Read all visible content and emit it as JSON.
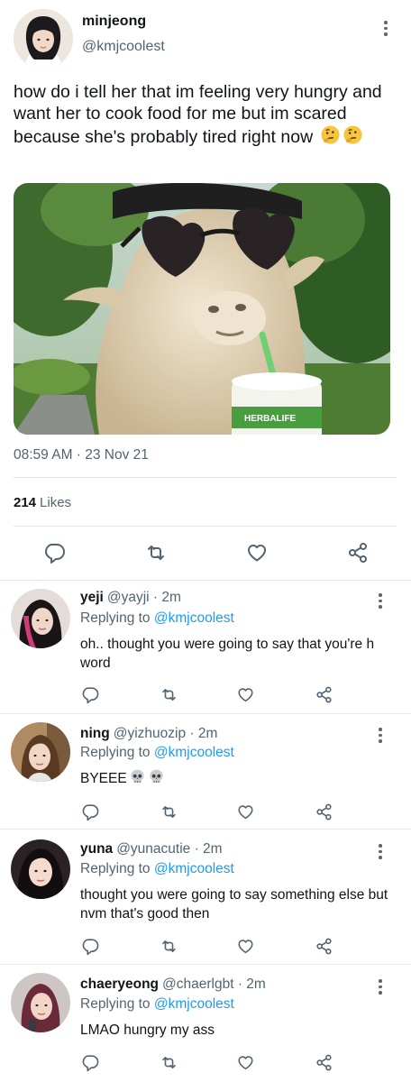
{
  "tweet": {
    "author_name": "minjeong",
    "author_handle": "@kmjcoolest",
    "text": "how do i tell her that im feeling very hungry and want her to cook food for me but im scared because she's probably tired right now",
    "emojis": [
      "thinking-face",
      "thinking-face"
    ],
    "media_label": "HERBALIFE",
    "timestamp": "08:59 AM · 23 Nov 21",
    "likes_count": "214",
    "likes_label": "Likes"
  },
  "icons": {
    "reply": "reply-icon",
    "retweet": "retweet-icon",
    "like": "heart-icon",
    "share": "share-icon",
    "more": "more-icon"
  },
  "colors": {
    "link": "#1d9bf0",
    "secondary_text": "#536471",
    "primary_text": "#0f1419"
  },
  "replies": [
    {
      "name": "yeji",
      "handle": "@yayji",
      "time": "· 2m",
      "replying_prefix": "Replying to",
      "replying_handle": "@kmjcoolest",
      "text": "oh.. thought you were going to say that you're h word"
    },
    {
      "name": "ning",
      "handle": "@yizhuozip",
      "time": "· 2m",
      "replying_prefix": "Replying to",
      "replying_handle": "@kmjcoolest",
      "text": "BYEEE",
      "emojis": [
        "skull",
        "skull"
      ]
    },
    {
      "name": "yuna",
      "handle": "@yunacutie",
      "time": "· 2m",
      "replying_prefix": "Replying to",
      "replying_handle": "@kmjcoolest",
      "text": "thought you were going to say something else but nvm that's good then"
    },
    {
      "name": "chaeryeong",
      "handle": "@chaerlgbt",
      "time": "· 2m",
      "replying_prefix": "Replying to",
      "replying_handle": "@kmjcoolest",
      "text": "LMAO hungry my ass"
    }
  ]
}
